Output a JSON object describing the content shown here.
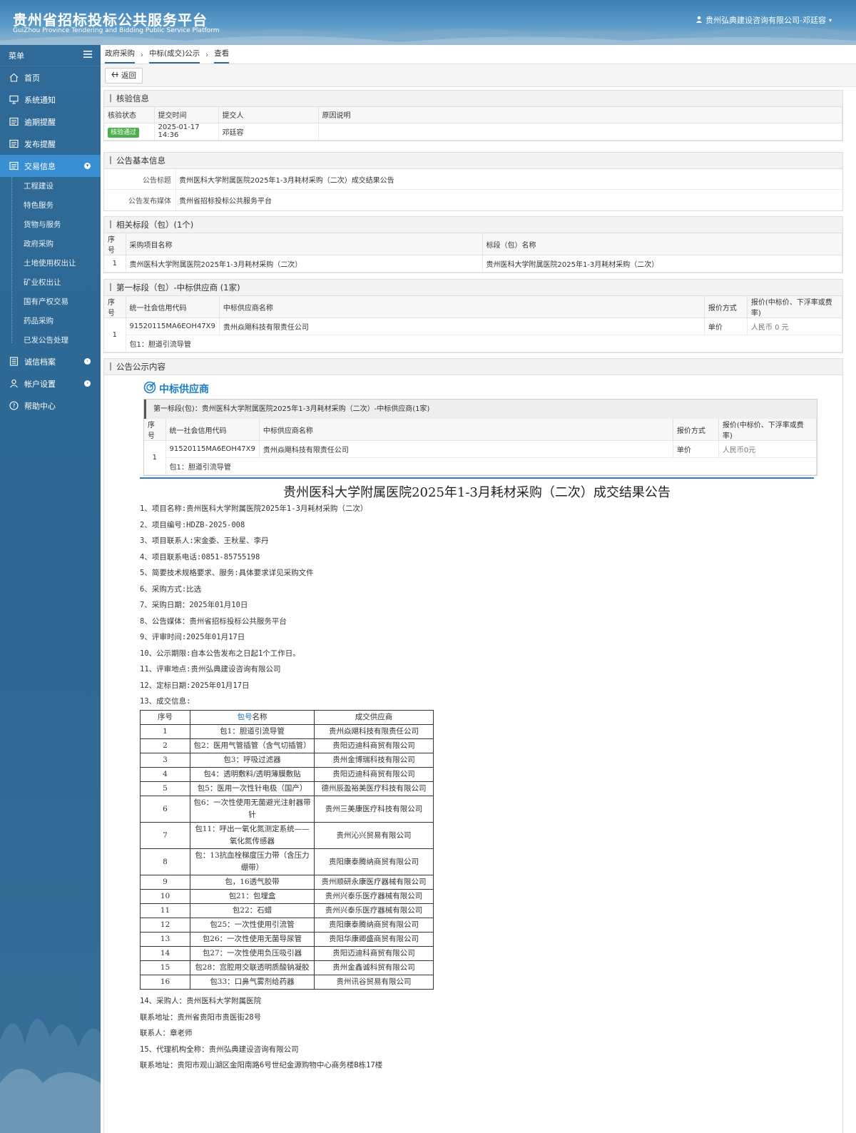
{
  "header": {
    "title": "贵州省招标投标公共服务平台",
    "subtitle": "GuiZhou Province Tendering and Bidding Public Service Platform",
    "user": "贵州弘典建设咨询有限公司-邓廷容"
  },
  "sidebar": {
    "menu_label": "菜单",
    "items": [
      {
        "label": "首页",
        "icon": "home-icon"
      },
      {
        "label": "系统通知",
        "icon": "monitor-icon"
      },
      {
        "label": "逾期提醒",
        "icon": "doc-icon"
      },
      {
        "label": "发布提醒",
        "icon": "doc-icon"
      },
      {
        "label": "交易信息",
        "icon": "doc-icon",
        "active": true
      }
    ],
    "sub_items": [
      "工程建设",
      "特色服务",
      "货物与服务",
      "政府采购",
      "土地使用权出让",
      "矿业权出让",
      "国有产权交易",
      "药品采购",
      "已发公告处理"
    ],
    "bottom_items": [
      {
        "label": "诚信档案",
        "icon": "list-icon"
      },
      {
        "label": "帐户设置",
        "icon": "user-icon"
      },
      {
        "label": "帮助中心",
        "icon": "help-icon"
      }
    ]
  },
  "breadcrumb": [
    "政府采购",
    "中标(成交)公示",
    "查看"
  ],
  "toolbar": {
    "back_label": "返回"
  },
  "verify": {
    "title": "核验信息",
    "headers": [
      "核验状态",
      "提交时间",
      "提交人",
      "原因说明"
    ],
    "status": "核验通过",
    "time": "2025-01-17 14:36",
    "submitter": "邓廷容",
    "reason": ""
  },
  "basic": {
    "title": "公告基本信息",
    "title_label": "公告标题",
    "title_value": "贵州医科大学附属医院2025年1-3月耗材采购（二次）成交结果公告",
    "media_label": "公告发布媒体",
    "media_value": "贵州省招标投标公共服务平台"
  },
  "sections": {
    "title": "相关标段（包）(1个)",
    "headers": [
      "序号",
      "采购项目名称",
      "标段（包）名称"
    ],
    "rows": [
      {
        "no": "1",
        "project": "贵州医科大学附属医院2025年1-3月耗材采购（二次）",
        "section": "贵州医科大学附属医院2025年1-3月耗材采购（二次）"
      }
    ]
  },
  "supplier": {
    "title": "第一标段（包）-中标供应商 (1家)",
    "headers": [
      "序号",
      "统一社会信用代码",
      "中标供应商名称",
      "报价方式",
      "报价(中标价、下浮率或费率)"
    ],
    "no": "1",
    "code": "91520115MA6EOH47X9",
    "name": "贵州焱飓科技有限责任公司",
    "method": "单价",
    "price": "人民币 0 元",
    "package": "包1：胆道引流导管"
  },
  "notice": {
    "title": "公告公示内容",
    "winner_heading": "中标供应商",
    "bar": "第一标段(包)：贵州医科大学附属医院2025年1-3月耗材采购（二次）-中标供应商(1家)",
    "headers": [
      "序号",
      "统一社会信用代码",
      "中标供应商名称",
      "报价方式",
      "报价(中标价、下浮率或费率)"
    ],
    "no": "1",
    "code": "91520115MA6EOH47X9",
    "name": "贵州焱飓科技有限责任公司",
    "method": "单价",
    "price": "人民币0元",
    "package": "包1：胆道引流导管"
  },
  "doc": {
    "title": "贵州医科大学附属医院2025年1-3月耗材采购（二次）成交结果公告",
    "lines": [
      "1、项目名称:贵州医科大学附属医院2025年1-3月耗材采购（二次）",
      "2、项目编号:HDZB-2025-008",
      "3、项目联系人:宋金委、王秋星、李丹",
      "4、项目联系电话:0851-85755198",
      "5、简要技术规格要求、服务:具体要求详见采购文件",
      "6、采购方式:比选",
      "7、采购日期：2025年01月10日",
      "8、公告媒体：贵州省招标投标公共服务平台",
      "9、评审时间:2025年01月17日",
      "10、公示期限:自本公告发布之日起1个工作日。",
      "11、评审地点:贵州弘典建设咨询有限公司",
      "12、定标日期:2025年01月17日",
      "13、成交信息:"
    ],
    "table_headers": [
      "序号",
      "包号",
      "名称",
      "成交供应商"
    ],
    "rows": [
      [
        "1",
        "包1：胆道引流导管",
        "贵州焱飓科技有限责任公司"
      ],
      [
        "2",
        "包2：医用气管插管（含气切插管）",
        "贵阳迈迪科商贸有限公司"
      ],
      [
        "3",
        "包3：呼吸过滤器",
        "贵州金博瑞科技有限公司"
      ],
      [
        "4",
        "包4：透明敷料/透明薄膜敷贴",
        "贵阳迈迪科商贸有限公司"
      ],
      [
        "5",
        "包5：医用一次性针电极（国产）",
        "德州辰盈裕美医疗科技有限公司"
      ],
      [
        "6",
        "包6：一次性使用无菌避光注射器带针",
        "贵州三美康医疗科技有限公司"
      ],
      [
        "7",
        "包11：呼出一氧化氮测定系统——氧化氮传感器",
        "贵州沁兴贸易有限公司"
      ],
      [
        "8",
        "包：13抗血栓梯度压力带（含压力绷带）",
        "贵阳康泰腾纳商贸有限公司"
      ],
      [
        "9",
        "包，16透气胶带",
        "贵州顺研永康医疗器械有限公司"
      ],
      [
        "10",
        "包21：包埋盒",
        "贵州兴泰乐医疗器械有限公司"
      ],
      [
        "11",
        "包22：石蜡",
        "贵州兴泰乐医疗器械有限公司"
      ],
      [
        "12",
        "包25：一次性使用引流管",
        "贵阳康泰腾纳商贸有限公司"
      ],
      [
        "13",
        "包26：一次性使用无菌导尿管",
        "贵阳华康卿盛商贸有限公司"
      ],
      [
        "14",
        "包27：一次性使用负压吸引器",
        "贵阳迈迪科商贸有限公司"
      ],
      [
        "15",
        "包28：宫腔用交联透明质酸钠凝胶",
        "贵州金鑫诚科贸有限公司"
      ],
      [
        "16",
        "包33：口鼻气雾剂给药器",
        "贵州讯谷贸易有限公司"
      ]
    ],
    "footer": [
      "14、采购人：贵州医科大学附属医院",
      "联系地址：贵州省贵阳市贵医街28号",
      "联系人：章老师",
      "15、代理机构全称：贵州弘典建设咨询有限公司",
      "联系地址：贵阳市观山湖区金阳南路6号世纪金源购物中心商务楼B栋17楼"
    ]
  }
}
